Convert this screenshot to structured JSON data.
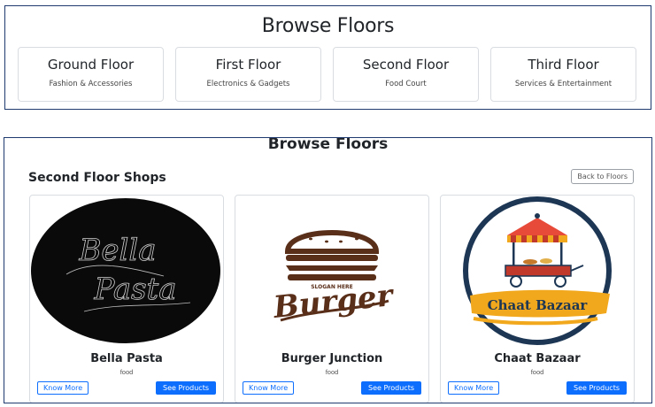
{
  "top_panel": {
    "title": "Browse Floors",
    "floors": [
      {
        "name": "Ground Floor",
        "desc": "Fashion & Accessories"
      },
      {
        "name": "First Floor",
        "desc": "Electronics & Gadgets"
      },
      {
        "name": "Second Floor",
        "desc": "Food Court"
      },
      {
        "name": "Third Floor",
        "desc": "Services & Entertainment"
      }
    ]
  },
  "bottom_panel": {
    "title": "Browse Floors",
    "section_title": "Second Floor Shops",
    "back_label": "Back to Floors",
    "shops": [
      {
        "name": "Bella Pasta",
        "category": "food",
        "logo_text_1": "Bella",
        "logo_text_2": "Pasta",
        "know_label": "Know More",
        "see_label": "See Products"
      },
      {
        "name": "Burger Junction",
        "category": "food",
        "logo_text": "Burger",
        "slogan": "SLOGAN HERE",
        "know_label": "Know More",
        "see_label": "See Products"
      },
      {
        "name": "Chaat Bazaar",
        "category": "food",
        "logo_text": "Chaat Bazaar",
        "know_label": "Know More",
        "see_label": "See Products"
      }
    ]
  },
  "colors": {
    "accent": "#0d6efd",
    "frame": "#1f3a6e",
    "burger_brown": "#5a2f1a",
    "chaat_navy": "#1c3654",
    "chaat_orange": "#f2a81d"
  }
}
